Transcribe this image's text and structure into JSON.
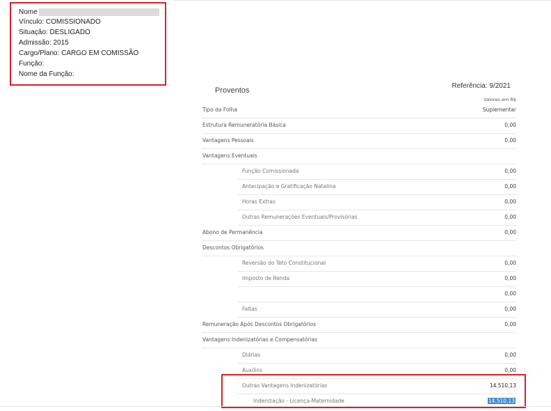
{
  "employee": {
    "name_label": "Nome",
    "vinculo": "Vínculo: COMISSIONADO",
    "situacao": "Situação: DESLIGADO",
    "admissao": "Admissão: 2015",
    "cargo": "Cargo/Plano: CARGO EM COMISSÃO",
    "funcao": "Função:",
    "nome_funcao": "Nome da Função:"
  },
  "proventos": {
    "title": "Proventos",
    "referencia": "Referência: 9/2021",
    "currency_note": "Valores em R$",
    "header": {
      "label": "Tipo da Folha",
      "value": "Suplementar"
    },
    "rows": [
      {
        "label": "Estrutura Remuneratória Básica",
        "value": "0,00"
      },
      {
        "label": "Vantagens Pessoais",
        "value": "0,00"
      },
      {
        "label": "Vantagens Eventuais",
        "value": ""
      },
      {
        "label": "Função Comissionada",
        "value": "0,00"
      },
      {
        "label": "Antecipação e Gratificação Natalina",
        "value": "0,00"
      },
      {
        "label": "Horas Extras",
        "value": "0,00"
      },
      {
        "label": "Outras Remunerações Eventuais/Provisórias",
        "value": "0,00"
      },
      {
        "label": "Abono de Permanência",
        "value": "0,00"
      },
      {
        "label": "Descontos Obrigatórios",
        "value": ""
      },
      {
        "label": "Reversão do Teto Constitucional",
        "value": "0,00"
      },
      {
        "label": "Imposto de Renda",
        "value": "0,00"
      },
      {
        "label": "",
        "value": "0,00"
      },
      {
        "label": "Faltas",
        "value": "0,00"
      },
      {
        "label": "Remuneração Após Descontos Obrigatórios",
        "value": "0,00"
      },
      {
        "label": "Vantagens Indenizatórias e Compensatórias",
        "value": ""
      },
      {
        "label": "Diárias",
        "value": "0,00"
      },
      {
        "label": "Auxílios",
        "value": "0,00"
      },
      {
        "label": "Outras Vantagens Indenizatórias",
        "value": "14.510,13"
      },
      {
        "label": "Indenização - Licença-Maternidade",
        "value": "14.510,13"
      }
    ]
  }
}
